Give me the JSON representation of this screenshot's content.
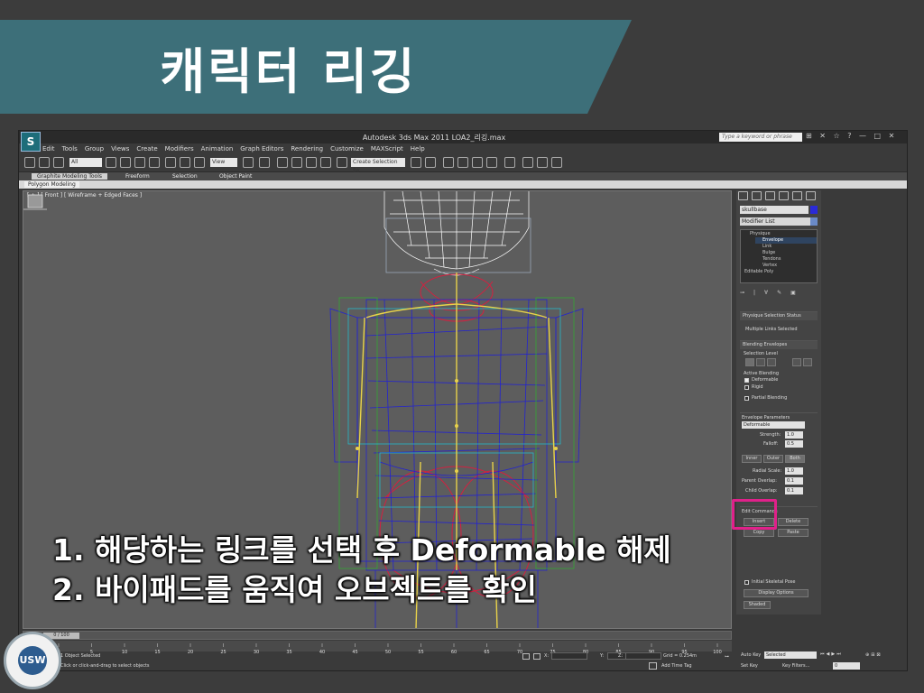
{
  "slide": {
    "title": "캐릭터 리깅",
    "instructions": [
      "1.  해당하는 링크를 선택 후 Deformable 해제",
      "2.  바이패드를 움직여 오브젝트를 확인"
    ]
  },
  "app": {
    "logo": "S",
    "window_title": "Autodesk 3ds Max  2011      LOA2_리깅.max",
    "search_placeholder": "Type a keyword or phrase",
    "menu": [
      "Edit",
      "Tools",
      "Group",
      "Views",
      "Create",
      "Modifiers",
      "Animation",
      "Graph Editors",
      "Rendering",
      "Customize",
      "MAXScript",
      "Help"
    ],
    "toolbar": {
      "selection_filter": "All",
      "ref_coord": "View",
      "named_selection": "Create Selection Se"
    },
    "ribbon_tabs": [
      "Graphite Modeling Tools",
      "Freeform",
      "Selection",
      "Object Paint"
    ],
    "ribbon_panel_label": "Polygon Modeling",
    "viewport_label": "[ + ] [ Front ] [ Wireframe + Edged Faces ]",
    "command_panel": {
      "object_name": "skullbase",
      "modifier_list": "Modifier List",
      "stack": [
        "Physique",
        "Envelope",
        "Link",
        "Bulge",
        "Tendons",
        "Vertex",
        "Editable Poly"
      ],
      "selected_stack_item": "Envelope",
      "physique_status_title": "Physique Selection Status",
      "physique_status_value": "Multiple Links Selected",
      "blending_title": "Blending Envelopes",
      "selection_level": "Selection Level",
      "active_blending": "Active Blending",
      "deformable": "Deformable",
      "rigid": "Rigid",
      "partial_blending": "Partial Blending",
      "envelope_params": "Envelope Parameters",
      "envelope_type": "Deformable",
      "strength_label": "Strength:",
      "strength": "1.0",
      "falloff_label": "Falloff:",
      "falloff": "0.5",
      "inner": "Inner",
      "outer": "Outer",
      "both": "Both",
      "radial_scale_label": "Radial Scale:",
      "radial_scale": "1.0",
      "parent_overlap_label": "Parent Overlap:",
      "parent_overlap": "0.1",
      "child_overlap_label": "Child Overlap:",
      "child_overlap": "0.1",
      "edit_commands": "Edit Commands",
      "insert": "Insert",
      "delete": "Delete",
      "copy": "Copy",
      "paste": "Paste",
      "initial_skeletal_pose": "Initial Skeletal Pose",
      "display_options": "Display Options",
      "shaded": "Shaded"
    },
    "timeline": {
      "slider": "0 / 100",
      "ticks": [
        "0",
        "5",
        "10",
        "15",
        "20",
        "25",
        "30",
        "35",
        "40",
        "45",
        "50",
        "55",
        "60",
        "65",
        "70",
        "75",
        "80",
        "85",
        "90",
        "95",
        "100"
      ]
    },
    "status": {
      "selection": "1 Object Selected",
      "prompt": "Click or click-and-drag to select objects",
      "x_label": "X:",
      "y_label": "Y:",
      "z_label": "Z:",
      "grid": "Grid = 0.254m",
      "add_time_tag": "Add Time Tag",
      "auto_key": "Auto Key",
      "selected": "Selected",
      "set_key": "Set Key",
      "key_filters": "Key Filters...",
      "frame": "0"
    }
  },
  "seal": {
    "text": "USW"
  },
  "colors": {
    "banner": "#3d6f79",
    "highlight": "#e0218a",
    "skin_wire": "#1c1cc8",
    "bone": "#e8d24a",
    "selected": "#d42040"
  }
}
